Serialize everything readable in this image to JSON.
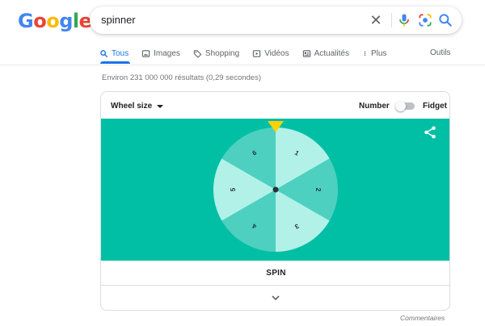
{
  "logo": {
    "letters": [
      {
        "ch": "G",
        "color": "#4285f4"
      },
      {
        "ch": "o",
        "color": "#ea4335"
      },
      {
        "ch": "o",
        "color": "#fbbc05"
      },
      {
        "ch": "g",
        "color": "#4285f4"
      },
      {
        "ch": "l",
        "color": "#34a853"
      },
      {
        "ch": "e",
        "color": "#ea4335"
      }
    ]
  },
  "search": {
    "query": "spinner",
    "clear_icon": "close-icon",
    "mic_icon": "mic-icon",
    "lens_icon": "camera-lens-icon",
    "search_icon": "search-icon"
  },
  "tabs": [
    {
      "label": "Tous",
      "icon": "search-icon",
      "active": true
    },
    {
      "label": "Images",
      "icon": "image-icon",
      "active": false
    },
    {
      "label": "Shopping",
      "icon": "tag-icon",
      "active": false
    },
    {
      "label": "Vidéos",
      "icon": "play-icon",
      "active": false
    },
    {
      "label": "Actualités",
      "icon": "news-icon",
      "active": false
    },
    {
      "label": "Plus",
      "icon": "more-vert-icon",
      "active": false
    }
  ],
  "tools_label": "Outils",
  "results_stats": "Environ 231 000 000 résultats (0,29 secondes)",
  "spinner": {
    "wheel_size_label": "Wheel size",
    "number_label": "Number",
    "fidget_label": "Fidget",
    "mode_toggle_on": false,
    "spin_label": "SPIN",
    "segments": [
      "1",
      "2",
      "3",
      "4",
      "5",
      "6"
    ],
    "colors": {
      "background": "#00bfa5",
      "segment_dark": "#4dd0bf",
      "segment_light": "#b2f1e8",
      "pointer": "#fbd107",
      "hub": "#263238"
    }
  },
  "feedback_label": "Commentaires"
}
